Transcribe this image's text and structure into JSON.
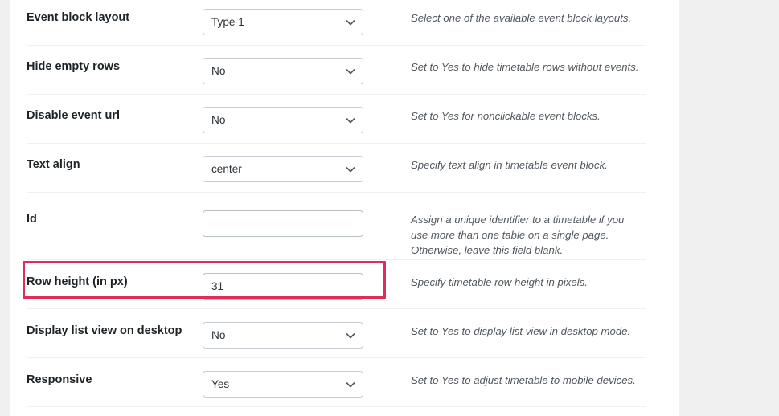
{
  "theme": {
    "page_background": "#f0f0f1",
    "panel_background": "#ffffff",
    "label_color": "#1d2327",
    "description_color": "#50575e",
    "highlight_color": "#e02c5b",
    "field_border_color": "#c7cdd3"
  },
  "settings_form": {
    "rows": [
      {
        "label": "Event block layout",
        "control": {
          "kind": "select",
          "value": "Type 1",
          "icon": "chevron-down-icon"
        },
        "description": "Select one of the available event block layouts.",
        "highlighted": false
      },
      {
        "label": "Hide empty rows",
        "control": {
          "kind": "select",
          "value": "No",
          "icon": "chevron-down-icon"
        },
        "description": "Set to Yes to hide timetable rows without events.",
        "highlighted": false
      },
      {
        "label": "Disable event url",
        "control": {
          "kind": "select",
          "value": "No",
          "icon": "chevron-down-icon"
        },
        "description": "Set to Yes for nonclickable event blocks.",
        "highlighted": false
      },
      {
        "label": "Text align",
        "control": {
          "kind": "select",
          "value": "center",
          "icon": "chevron-down-icon"
        },
        "description": "Specify text align in timetable event block.",
        "highlighted": false
      },
      {
        "label": "Id",
        "control": {
          "kind": "text",
          "value": "",
          "placeholder": ""
        },
        "description": "Assign a unique identifier to a timetable if you use more than one table on a single page. Otherwise, leave this field blank.",
        "highlighted": false
      },
      {
        "label": "Row height (in px)",
        "control": {
          "kind": "text",
          "value": "31",
          "placeholder": ""
        },
        "description": "Specify timetable row height in pixels.",
        "highlighted": true
      },
      {
        "label": "Display list view on desktop",
        "control": {
          "kind": "select",
          "value": "No",
          "icon": "chevron-down-icon"
        },
        "description": "Set to Yes to display list view in desktop mode.",
        "highlighted": false
      },
      {
        "label": "Responsive",
        "control": {
          "kind": "select",
          "value": "Yes",
          "icon": "chevron-down-icon"
        },
        "description": "Set to Yes to adjust timetable to mobile devices.",
        "highlighted": false
      }
    ]
  }
}
